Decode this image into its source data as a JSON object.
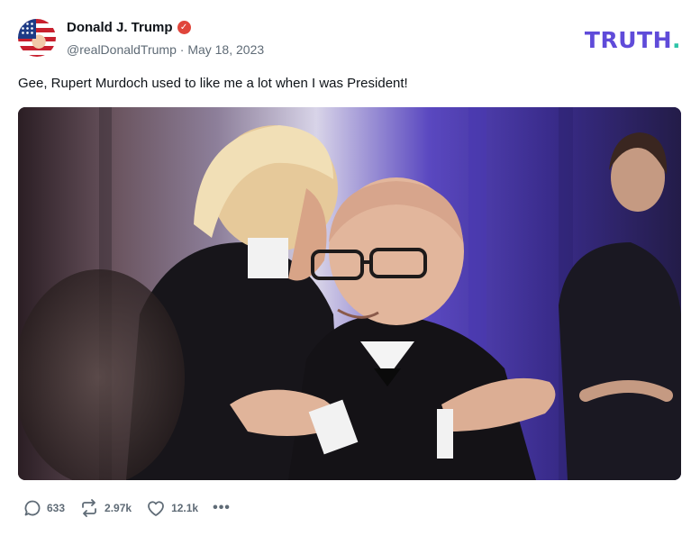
{
  "author": {
    "display_name": "Donald J. Trump",
    "verified_icon": "verified-badge-icon",
    "handle": "@realDonaldTrump",
    "separator": " · ",
    "date": "May 18, 2023"
  },
  "brand": {
    "logo_text": "TRUTH",
    "logo_dot": ".",
    "logo_color": "#5f4bd9",
    "dot_color": "#2ec4a8"
  },
  "post": {
    "text": "Gee, Rupert Murdoch used to like me a lot when I was President!"
  },
  "actions": {
    "replies": "633",
    "reposts": "2.97k",
    "likes": "12.1k",
    "more": "•••"
  },
  "icons": {
    "reply": "reply-icon",
    "repost": "repost-icon",
    "like": "heart-icon",
    "more": "more-icon"
  }
}
